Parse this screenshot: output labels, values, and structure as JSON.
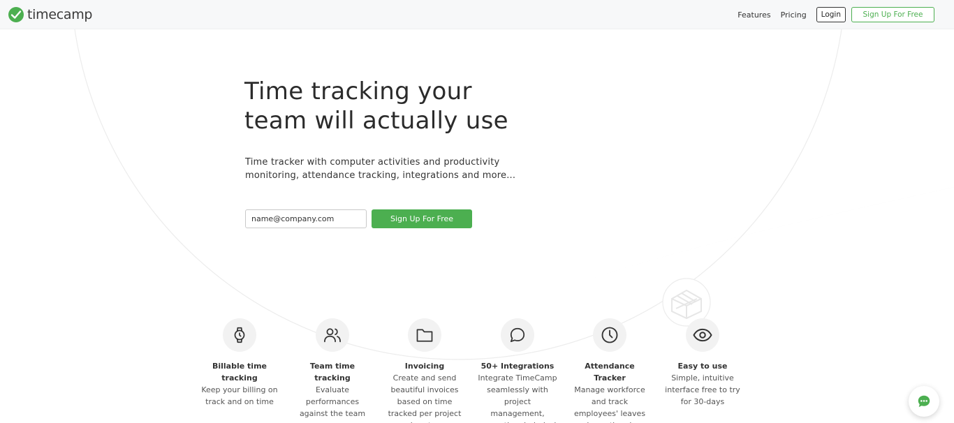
{
  "header": {
    "logo_text": "timecamp",
    "nav": {
      "features": "Features",
      "pricing": "Pricing",
      "login": "Login",
      "signup": "Sign Up For Free"
    }
  },
  "hero": {
    "title_line1": "Time tracking your",
    "title_line2": "team will actually use",
    "subtitle_line1": "Time tracker with computer activities and productivity",
    "subtitle_line2": "monitoring, attendance tracking, integrations and more...",
    "email_placeholder": "name@company.com",
    "signup_button": "Sign Up For Free"
  },
  "features": [
    {
      "icon": "watch-icon",
      "title": "Billable time tracking",
      "description": "Keep your billing on track and on time"
    },
    {
      "icon": "users-icon",
      "title": "Team time tracking",
      "description": "Evaluate performances against the team"
    },
    {
      "icon": "folder-icon",
      "title": "Invoicing",
      "description": "Create and send beautiful invoices based on time tracked per project and customer"
    },
    {
      "icon": "chat-bubble-icon",
      "title": "50+ Integrations",
      "description": "Integrate TimeCamp seamlessly with project management, accounting, helpdesk software and many"
    },
    {
      "icon": "clock-icon",
      "title": "Attendance Tracker",
      "description": "Manage workforce and track employees' leaves and vacation days"
    },
    {
      "icon": "eye-icon",
      "title": "Easy to use",
      "description": "Simple, intuitive interface free to try for 30-days"
    }
  ],
  "colors": {
    "brand_green": "#4caf50",
    "text_dark": "#2b2b2b",
    "header_bg": "#f7f8f9"
  }
}
